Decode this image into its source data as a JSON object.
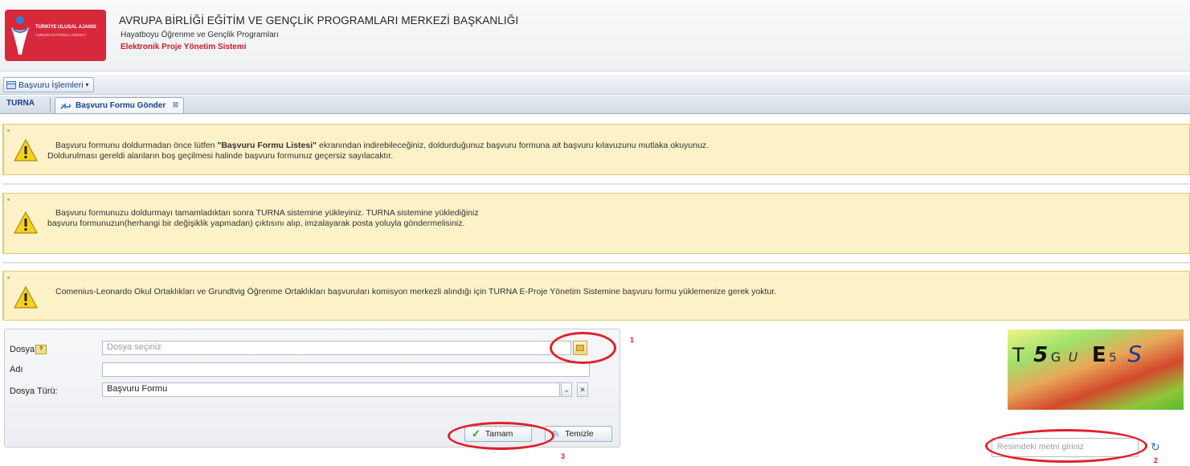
{
  "header": {
    "logo_line1": "TÜRKİYE ULUSAL AJANSI",
    "logo_line2": "TURKISH NATIONAL AGENCY",
    "title": "AVRUPA BİRLİĞİ EĞİTİM VE GENÇLİK PROGRAMLARI MERKEZİ BAŞKANLIĞI",
    "subtitle": "Hayatboyu Öğrenme ve Gençlik Programları",
    "system": "Elektronik Proje Yönetim Sistemi"
  },
  "menu": {
    "label": "Başvuru İşlemleri",
    "icon": "window-icon"
  },
  "tabs": {
    "home": "TURNA",
    "active": "Başvuru Formu Gönder",
    "active_icon": "upload-arrows-icon"
  },
  "notices": [
    {
      "line1_pre": "Başvuru formunu doldurmadan önce lütfen ",
      "line1_bold": "\"Başvuru Formu Listesi\"",
      "line1_post": " ekranından indirebileceğiniz, doldurduğunuz başvuru formuna ait başvuru kılavuzunu mutlaka okuyunuz.",
      "line2": "Doldurulması gereldi alanların boş geçilmesi halinde başvuru formunuz geçersiz sayılacaktır."
    },
    {
      "line1": "Başvuru formunuzu doldurmayı tamamladıktan sonra TURNA sistemine yükleyiniz. TURNA sistemine yüklediğiniz",
      "line2": "başvuru formunuzun(herhangi bir değişiklik yapmadan) çıktısını alıp, imzalayarak posta yoluyla göndermelisiniz."
    },
    {
      "line1": "Comenius-Leonardo Okul Ortaklıkları ve Grundtvig Öğrenme Ortaklıkları başvuruları komisyon merkezli alındığı için TURNA E-Proje Yönetim Sistemine başvuru formu yüklemenize gerek yoktur."
    }
  ],
  "form": {
    "file_label": "Dosya",
    "file_help": "?",
    "file_placeholder": "Dosya seçiniz",
    "name_label": "Adı",
    "name_value": "",
    "type_label": "Dosya Türü:",
    "type_value": "Başvuru Formu",
    "combo_arrow": "⌄",
    "combo_clear": "✕",
    "ok_label": "Tamam",
    "clear_label": "Temizle"
  },
  "captcha": {
    "chars": [
      "T",
      "5",
      "G",
      "U",
      "E",
      "5",
      "S"
    ],
    "input_placeholder": "Resimdeki metni giriniz"
  },
  "annotations": {
    "n1": "1",
    "n2": "2",
    "n3": "3"
  },
  "colors": {
    "highlight": "#e0202c",
    "warning_bg": "#fcf1c7",
    "brand_red": "#d8283c",
    "link_blue": "#15428b"
  }
}
